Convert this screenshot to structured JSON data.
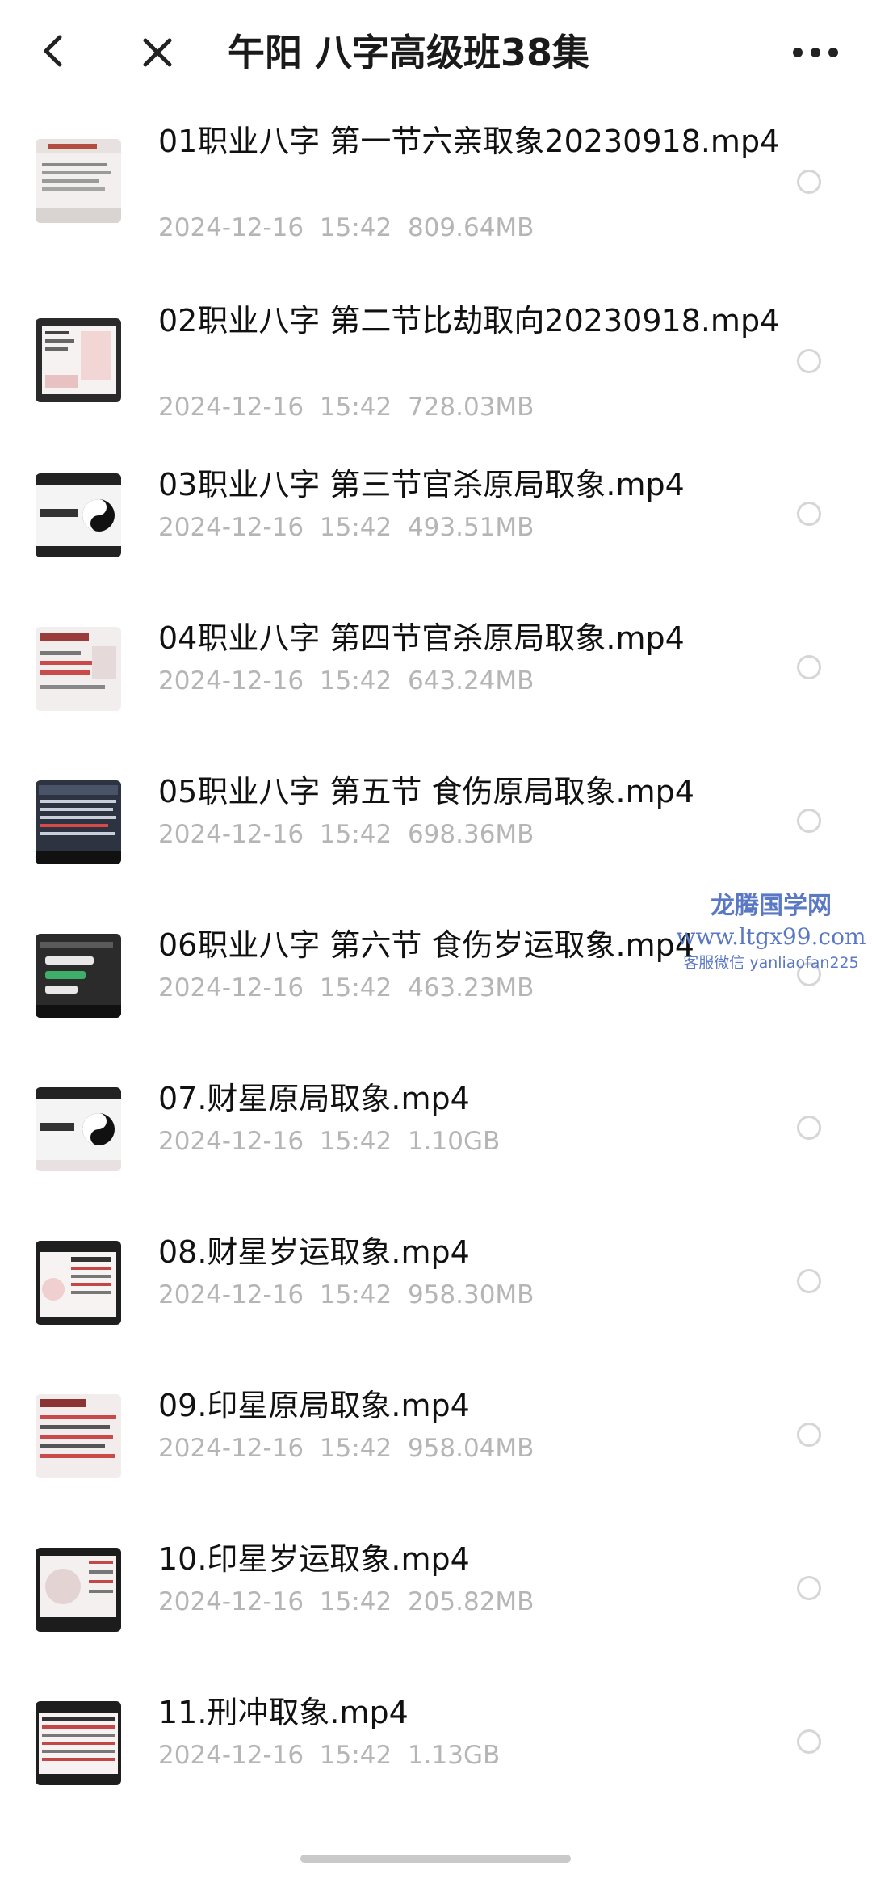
{
  "header": {
    "title": "午阳 八字高级班38集",
    "back_icon": "chevron-left-icon",
    "close_icon": "close-icon",
    "more_icon": "more-horizontal-icon"
  },
  "files": [
    {
      "name": "01职业八字 第一节六亲取象20230918.mp4",
      "date": "2024-12-16",
      "time": "15:42",
      "size": "809.64MB"
    },
    {
      "name": "02职业八字 第二节比劫取向20230918.mp4",
      "date": "2024-12-16",
      "time": "15:42",
      "size": "728.03MB"
    },
    {
      "name": "03职业八字 第三节官杀原局取象.mp4",
      "date": "2024-12-16",
      "time": "15:42",
      "size": "493.51MB"
    },
    {
      "name": "04职业八字 第四节官杀原局取象.mp4",
      "date": "2024-12-16",
      "time": "15:42",
      "size": "643.24MB"
    },
    {
      "name": "05职业八字 第五节 食伤原局取象.mp4",
      "date": "2024-12-16",
      "time": "15:42",
      "size": "698.36MB"
    },
    {
      "name": "06职业八字 第六节 食伤岁运取象.mp4",
      "date": "2024-12-16",
      "time": "15:42",
      "size": "463.23MB"
    },
    {
      "name": "07.财星原局取象.mp4",
      "date": "2024-12-16",
      "time": "15:42",
      "size": "1.10GB"
    },
    {
      "name": "08.财星岁运取象.mp4",
      "date": "2024-12-16",
      "time": "15:42",
      "size": "958.30MB"
    },
    {
      "name": "09.印星原局取象.mp4",
      "date": "2024-12-16",
      "time": "15:42",
      "size": "958.04MB"
    },
    {
      "name": "10.印星岁运取象.mp4",
      "date": "2024-12-16",
      "time": "15:42",
      "size": "205.82MB"
    },
    {
      "name": "11.刑冲取象.mp4",
      "date": "2024-12-16",
      "time": "15:42",
      "size": "1.13GB"
    }
  ],
  "watermark": {
    "line1": "龙腾国学网",
    "line2": "www.ltgx99.com",
    "line3": "客服微信 yanliaofan225"
  },
  "colors": {
    "meta_text": "#b5b5b5",
    "radio_border": "#d6d6d6",
    "watermark": "#5a78c4"
  }
}
